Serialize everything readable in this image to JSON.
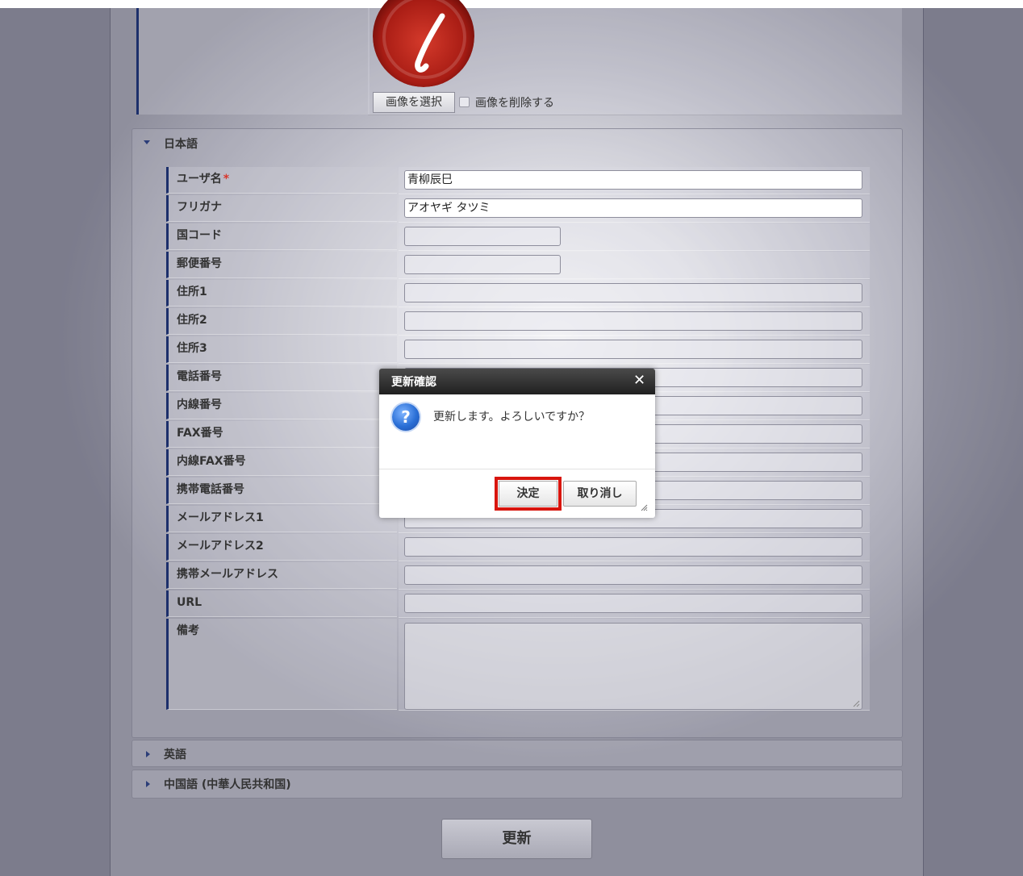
{
  "image_field": {
    "select_button": "画像を選択",
    "delete_checkbox_label": "画像を削除する",
    "delete_checked": false
  },
  "sections": {
    "japanese": {
      "title": "日本語",
      "expanded": true,
      "rows": [
        {
          "label": "ユーザ名",
          "required_mark": "*",
          "value": "青柳辰巳"
        },
        {
          "label": "フリガナ",
          "value": "アオヤギ タツミ"
        },
        {
          "label": "国コード",
          "value": ""
        },
        {
          "label": "郵便番号",
          "value": ""
        },
        {
          "label": "住所1",
          "value": ""
        },
        {
          "label": "住所2",
          "value": ""
        },
        {
          "label": "住所3",
          "value": ""
        },
        {
          "label": "電話番号",
          "value": ""
        },
        {
          "label": "内線番号",
          "value": ""
        },
        {
          "label": "FAX番号",
          "value": ""
        },
        {
          "label": "内線FAX番号",
          "value": ""
        },
        {
          "label": "携帯電話番号",
          "value": ""
        },
        {
          "label": "メールアドレス1",
          "value": ""
        },
        {
          "label": "メールアドレス2",
          "value": ""
        },
        {
          "label": "携帯メールアドレス",
          "value": ""
        },
        {
          "label": "URL",
          "value": ""
        },
        {
          "label": "備考",
          "value": ""
        }
      ]
    },
    "english": {
      "title": "英語",
      "expanded": false
    },
    "chinese": {
      "title": "中国語 (中華人民共和国)",
      "expanded": false
    }
  },
  "update_button": "更新",
  "dialog": {
    "title": "更新確認",
    "close_icon": "close-icon",
    "icon": "question-icon",
    "message": "更新します。よろしいですか？",
    "ok_label": "決定",
    "cancel_label": "取り消し"
  },
  "colors": {
    "highlight": "#d8150e",
    "label_bar": "#1c2f6b",
    "required": "#d9362b"
  }
}
